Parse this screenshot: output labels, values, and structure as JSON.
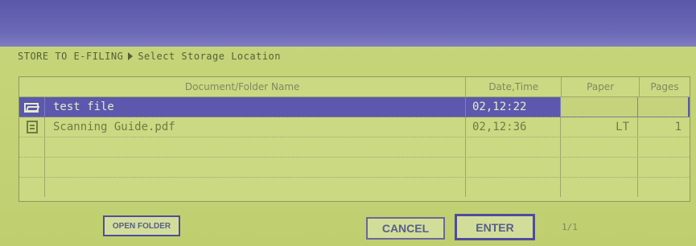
{
  "breadcrumb": {
    "root": "STORE TO E-FILING",
    "current": "Select Storage Location"
  },
  "table": {
    "headers": {
      "name": "Document/Folder Name",
      "date": "Date,Time",
      "paper": "Paper",
      "pages": "Pages"
    },
    "rows": [
      {
        "icon": "folder-icon",
        "name": "test file",
        "date": "02,12:22",
        "paper": "",
        "pages": "",
        "selected": true
      },
      {
        "icon": "document-icon",
        "name": "Scanning Guide.pdf",
        "date": "02,12:36",
        "paper": "LT",
        "pages": "1",
        "selected": false
      }
    ]
  },
  "buttons": {
    "open_folder": "OPEN FOLDER",
    "cancel": "CANCEL",
    "enter": "ENTER"
  },
  "pagination": "1/1",
  "colors": {
    "title_bar": "#5a57a8",
    "screen_bg": "#c7d67a",
    "selection": "#5b58ad"
  }
}
